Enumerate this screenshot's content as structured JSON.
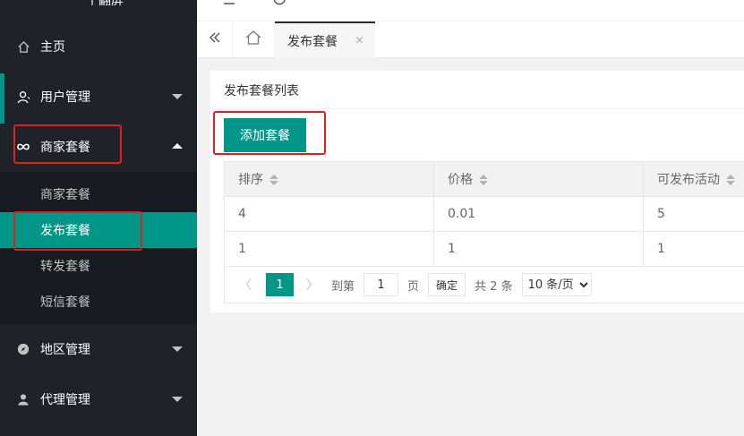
{
  "sidebar": {
    "logo_text": "一个翻屏",
    "items": [
      {
        "label": "主页"
      },
      {
        "label": "用户管理"
      },
      {
        "label": "商家套餐"
      },
      {
        "label": "地区管理"
      },
      {
        "label": "代理管理"
      }
    ],
    "sub_items": [
      {
        "label": "商家套餐"
      },
      {
        "label": "发布套餐"
      },
      {
        "label": "转发套餐"
      },
      {
        "label": "短信套餐"
      }
    ]
  },
  "tabs": {
    "active_tab": "发布套餐",
    "close_glyph": "×"
  },
  "card": {
    "title": "发布套餐列表",
    "add_button": "添加套餐"
  },
  "table": {
    "columns": [
      "排序",
      "价格",
      "可发布活动"
    ],
    "rows": [
      [
        "4",
        "0.01",
        "5"
      ],
      [
        "1",
        "1",
        "1"
      ]
    ]
  },
  "pager": {
    "prev": "〈",
    "current": "1",
    "next": "〉",
    "goto_label": "到第",
    "goto_value": "1",
    "page_unit": "页",
    "ok_label": "确定",
    "total": "共 2 条",
    "page_size": "10 条/页"
  },
  "colors": {
    "accent": "#009688",
    "sidebar_bg": "#20222a",
    "highlight_border": "#e02020"
  }
}
